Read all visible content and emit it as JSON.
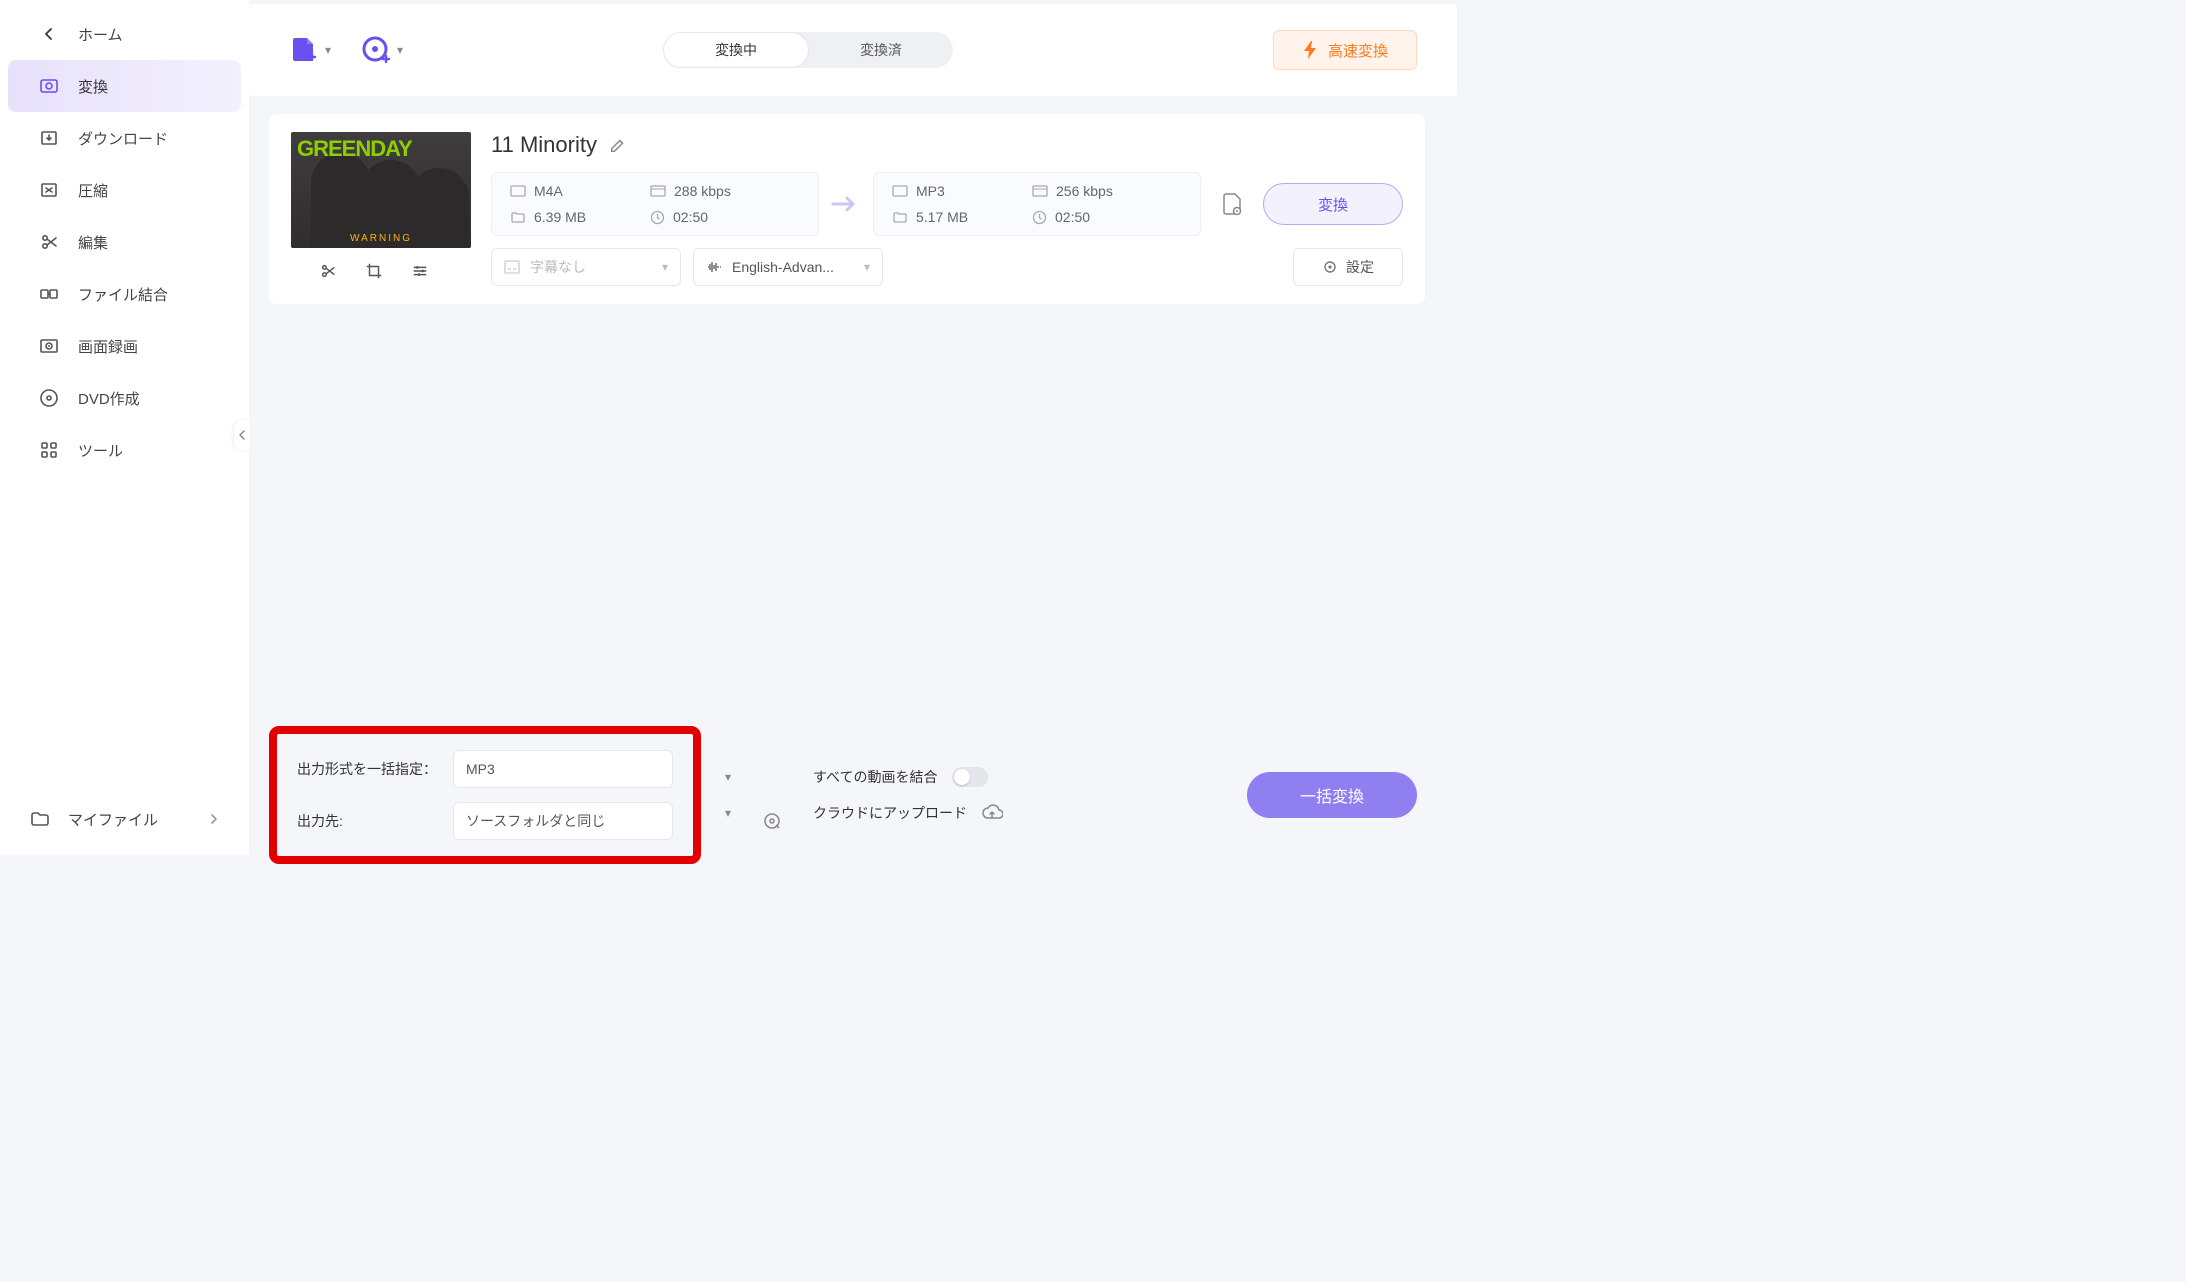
{
  "sidebar": {
    "home": "ホーム",
    "items": [
      {
        "label": "変換"
      },
      {
        "label": "ダウンロード"
      },
      {
        "label": "圧縮"
      },
      {
        "label": "編集"
      },
      {
        "label": "ファイル結合"
      },
      {
        "label": "画面録画"
      },
      {
        "label": "DVD作成"
      },
      {
        "label": "ツール"
      }
    ],
    "myfile": "マイファイル"
  },
  "topbar": {
    "tabs": {
      "converting": "変換中",
      "converted": "変換済"
    },
    "fast": "高速変換"
  },
  "file": {
    "album_top": "GREENDAY",
    "album_bottom": "WARNING",
    "title": "11 Minority",
    "src": {
      "format": "M4A",
      "bitrate": "288 kbps",
      "size": "6.39 MB",
      "duration": "02:50"
    },
    "dst": {
      "format": "MP3",
      "bitrate": "256 kbps",
      "size": "5.17 MB",
      "duration": "02:50"
    },
    "convert_btn": "変換",
    "subtitle_select": "字幕なし",
    "audio_select": "English-Advan...",
    "settings_btn": "設定"
  },
  "bottom": {
    "format_label": "出力形式を一括指定：",
    "format_value": "MP3",
    "dest_label": "出力先:",
    "dest_value": "ソースフォルダと同じ",
    "merge_label": "すべての動画を結合",
    "cloud_label": "クラウドにアップロード",
    "batch_btn": "一括変換"
  }
}
